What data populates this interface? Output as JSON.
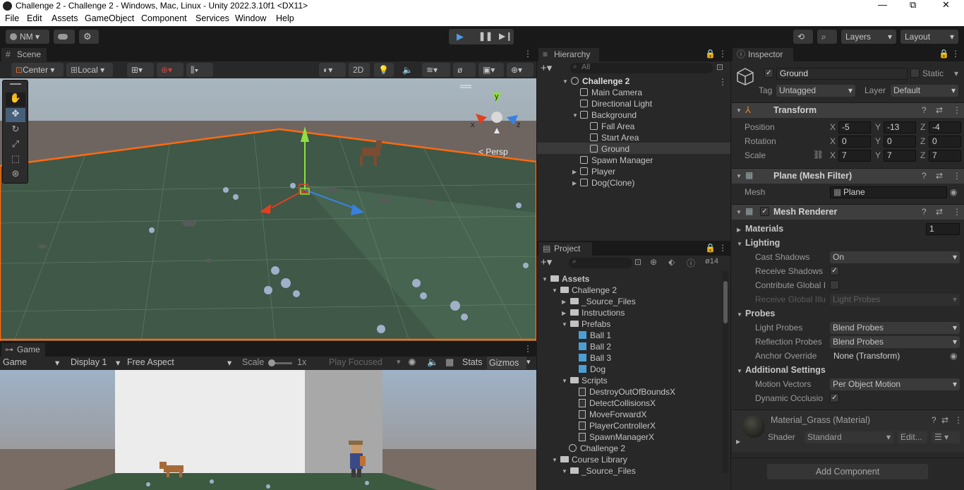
{
  "window": {
    "title": "Challenge 2 - Challenge 2 - Windows, Mac, Linux - Unity 2022.3.10f1 <DX11>",
    "controls": [
      "—",
      "⧉",
      "✕"
    ]
  },
  "menu": [
    "File",
    "Edit",
    "Assets",
    "GameObject",
    "Component",
    "Services",
    "Window",
    "Help"
  ],
  "toolbar": {
    "account": "NM",
    "layers": "Layers",
    "layout": "Layout"
  },
  "scene": {
    "tab": "Scene",
    "pivot": "Center",
    "space": "Local",
    "mode2d": "2D",
    "persp": "< Persp",
    "gizmo_x": "x",
    "gizmo_y": "y",
    "gizmo_z": "z"
  },
  "game": {
    "tab": "Game",
    "mode": "Game",
    "display": "Display 1",
    "aspect": "Free Aspect",
    "scale_label": "Scale",
    "scale_value": "1x",
    "play_focused": "Play Focused",
    "stats": "Stats",
    "gizmos": "Gizmos"
  },
  "hierarchy": {
    "tab": "Hierarchy",
    "search_placeholder": "All",
    "scene": "Challenge 2",
    "items": [
      {
        "label": "Main Camera"
      },
      {
        "label": "Directional Light"
      },
      {
        "label": "Background"
      },
      {
        "label": "Fall Area"
      },
      {
        "label": "Start Area"
      },
      {
        "label": "Ground"
      },
      {
        "label": "Spawn Manager"
      },
      {
        "label": "Player"
      },
      {
        "label": "Dog(Clone)"
      }
    ]
  },
  "project": {
    "tab": "Project",
    "hidden_count": "14",
    "items": [
      {
        "label": "Assets"
      },
      {
        "label": "Challenge 2"
      },
      {
        "label": "_Source_Files"
      },
      {
        "label": "Instructions"
      },
      {
        "label": "Prefabs"
      },
      {
        "label": "Ball 1"
      },
      {
        "label": "Ball 2"
      },
      {
        "label": "Ball 3"
      },
      {
        "label": "Dog"
      },
      {
        "label": "Scripts"
      },
      {
        "label": "DestroyOutOfBoundsX"
      },
      {
        "label": "DetectCollisionsX"
      },
      {
        "label": "MoveForwardX"
      },
      {
        "label": "PlayerControllerX"
      },
      {
        "label": "SpawnManagerX"
      },
      {
        "label": "Challenge 2"
      },
      {
        "label": "Course Library"
      },
      {
        "label": "_Source_Files"
      }
    ]
  },
  "inspector": {
    "tab": "Inspector",
    "object_name": "Ground",
    "static_label": "Static",
    "tag_label": "Tag",
    "tag_value": "Untagged",
    "layer_label": "Layer",
    "layer_value": "Default",
    "transform": {
      "title": "Transform",
      "position_label": "Position",
      "rotation_label": "Rotation",
      "scale_label": "Scale",
      "position": {
        "x": "-5",
        "y": "-13",
        "z": "-4"
      },
      "rotation": {
        "x": "0",
        "y": "0",
        "z": "0"
      },
      "scale": {
        "x": "7",
        "y": "7",
        "z": "7"
      }
    },
    "mesh_filter": {
      "title": "Plane (Mesh Filter)",
      "mesh_label": "Mesh",
      "mesh_value": "Plane"
    },
    "mesh_renderer": {
      "title": "Mesh Renderer",
      "materials_label": "Materials",
      "materials_count": "1",
      "lighting_label": "Lighting",
      "cast_shadows_label": "Cast Shadows",
      "cast_shadows_value": "On",
      "receive_shadows_label": "Receive Shadows",
      "contribute_gi_label": "Contribute Global I",
      "receive_gi_label": "Receive Global Illu",
      "receive_gi_value": "Light Probes",
      "probes_label": "Probes",
      "light_probes_label": "Light Probes",
      "light_probes_value": "Blend Probes",
      "reflection_probes_label": "Reflection Probes",
      "reflection_probes_value": "Blend Probes",
      "anchor_override_label": "Anchor Override",
      "anchor_override_value": "None (Transform)",
      "additional_label": "Additional Settings",
      "motion_vectors_label": "Motion Vectors",
      "motion_vectors_value": "Per Object Motion",
      "dynamic_occlusion_label": "Dynamic Occlusio"
    },
    "material": {
      "title": "Material_Grass (Material)",
      "shader_label": "Shader",
      "shader_value": "Standard",
      "edit_label": "Edit..."
    },
    "add_component": "Add Component"
  }
}
